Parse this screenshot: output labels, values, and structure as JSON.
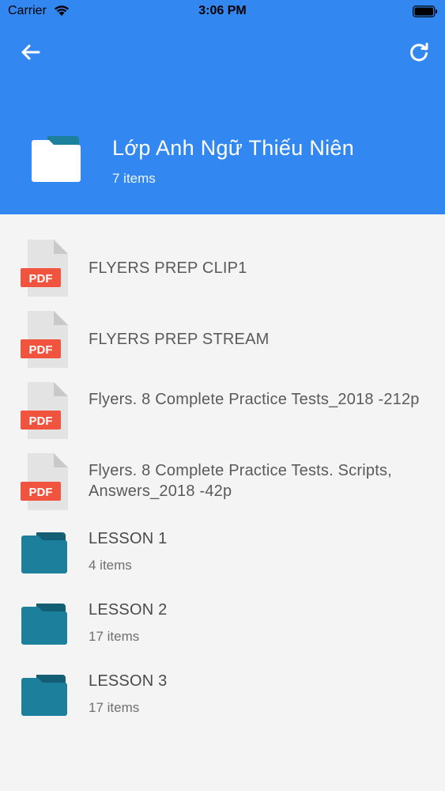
{
  "status_bar": {
    "carrier": "Carrier",
    "time": "3:06 PM"
  },
  "header": {
    "title": "Lớp Anh Ngữ Thiếu Niên",
    "item_count": "7 items",
    "background_color": "#3288f0"
  },
  "files": [
    {
      "name": "FLYERS PREP CLIP1",
      "badge": "PDF"
    },
    {
      "name": "FLYERS PREP STREAM",
      "badge": "PDF"
    },
    {
      "name": "Flyers. 8 Complete Practice Tests_2018 -212p",
      "badge": "PDF"
    },
    {
      "name": "Flyers. 8 Complete Practice Tests. Scripts, Answers_2018 -42p",
      "badge": "PDF"
    }
  ],
  "folders": [
    {
      "name": "LESSON 1",
      "count": "4 items"
    },
    {
      "name": "LESSON 2",
      "count": "17 items"
    },
    {
      "name": "LESSON 3",
      "count": "17 items"
    }
  ],
  "icons": {
    "back": "arrow-left-icon",
    "refresh": "refresh-icon",
    "pdf": "pdf-file-icon",
    "folder": "folder-icon"
  },
  "colors": {
    "pdf_badge": "#f0533e",
    "folder_teal": "#1c7f9b"
  }
}
